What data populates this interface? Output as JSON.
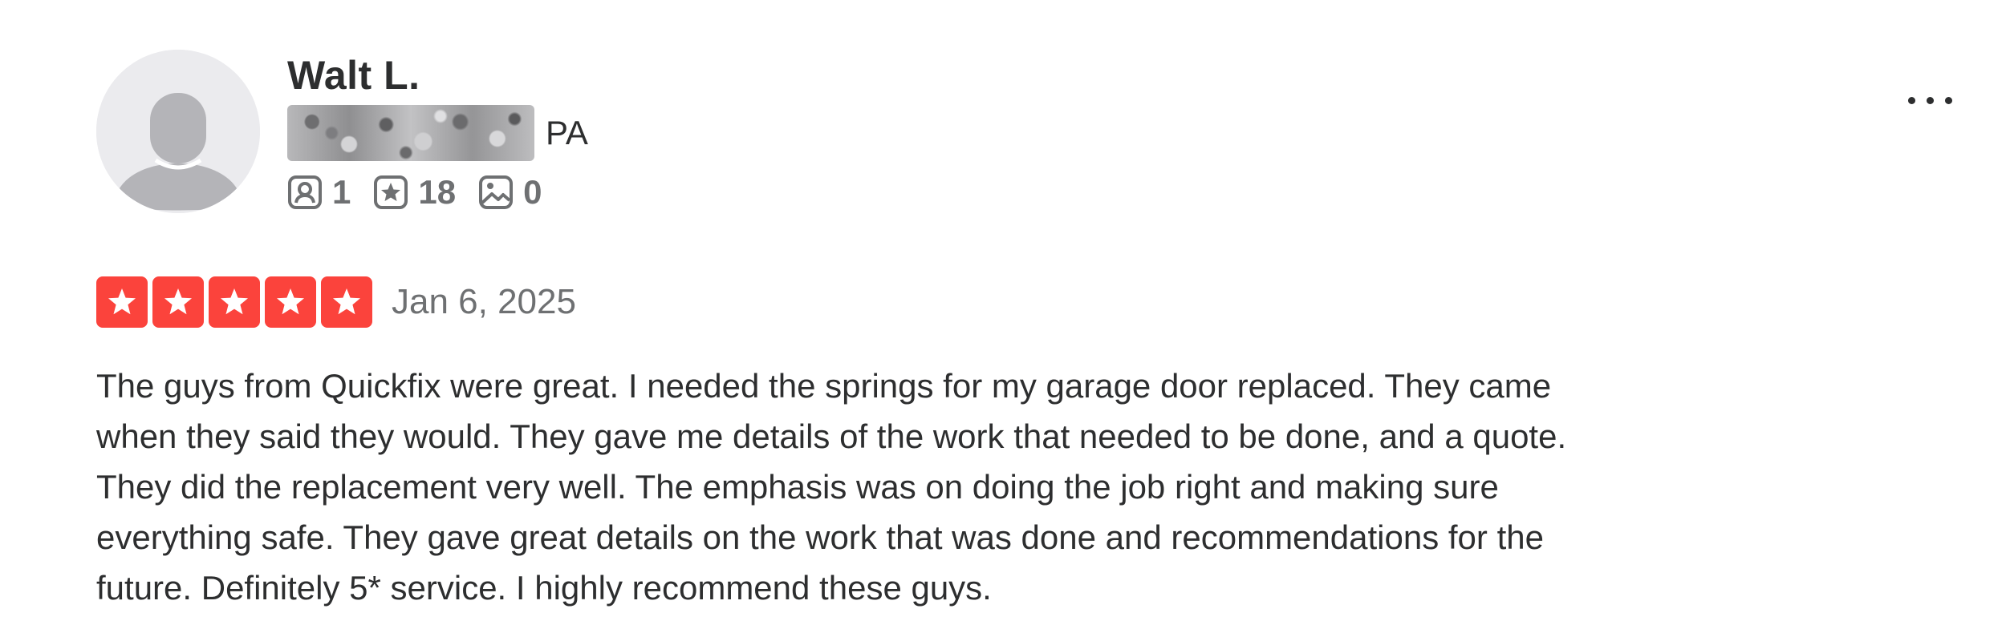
{
  "colors": {
    "star_red": "#fb433c",
    "text_primary": "#2d2e2f",
    "text_secondary": "#6e7072",
    "avatar_bg": "#ebebee",
    "avatar_silhouette": "#b4b4b8"
  },
  "reviewer": {
    "name": "Walt L.",
    "location_state": "PA",
    "avatar_icon": "default-user-avatar-icon",
    "stats": {
      "friends": {
        "icon": "friends-icon",
        "value": "1"
      },
      "reviews": {
        "icon": "reviews-star-icon",
        "value": "18"
      },
      "photos": {
        "icon": "photos-icon",
        "value": "0"
      }
    }
  },
  "menu": {
    "more_icon": "ellipsis-icon"
  },
  "review": {
    "rating": 5,
    "rating_max": 5,
    "date": "Jan 6, 2025",
    "text_lines": [
      "The guys from Quickfix were great. I needed the springs for my garage door replaced. They came",
      "when they said they would. They gave me details of the work that needed to be done, and a quote.",
      "They did the replacement very well. The emphasis was on doing the job right and making sure",
      "everything safe. They gave great details on the work that was done and recommendations for the",
      "future. Definitely 5* service. I highly recommend these guys."
    ]
  }
}
